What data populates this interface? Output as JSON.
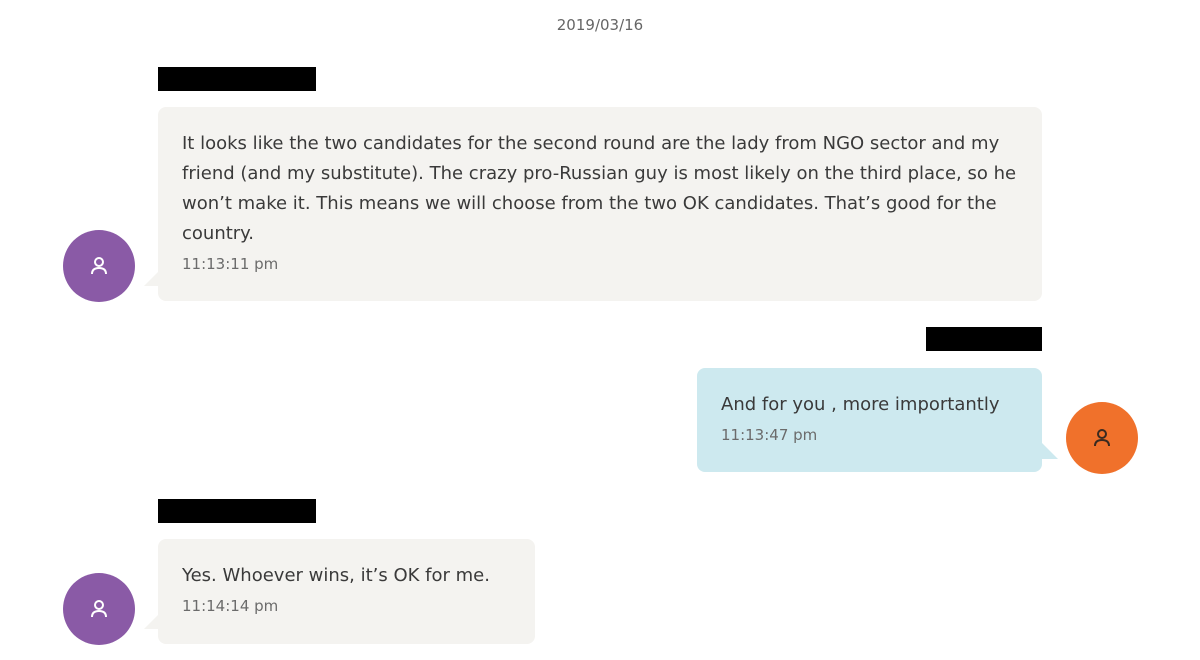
{
  "chat": {
    "date": "2019/03/16",
    "messages": [
      {
        "direction": "incoming",
        "sender_redacted": true,
        "text": "It looks like the two candidates for the second round are the lady from NGO sector and my friend (and my substitute). The crazy pro-Russian guy is most likely on the third place, so he won’t make it. This means we will choose from the two OK candidates. That’s good for the country.",
        "time": "11:13:11 pm",
        "avatar_color": "#8a5aa6",
        "avatar_icon": "user-icon"
      },
      {
        "direction": "outgoing",
        "sender_redacted": true,
        "text": "And for you , more importantly",
        "time": "11:13:47 pm",
        "avatar_color": "#f0712b",
        "avatar_icon": "user-icon"
      },
      {
        "direction": "incoming",
        "sender_redacted": true,
        "text": "Yes. Whoever wins, it’s OK for me.",
        "time": "11:14:14 pm",
        "avatar_color": "#8a5aa6",
        "avatar_icon": "user-icon"
      }
    ]
  },
  "colors": {
    "incoming_bubble": "#f4f3f0",
    "outgoing_bubble": "#cde9ef",
    "redaction": "#000000"
  }
}
